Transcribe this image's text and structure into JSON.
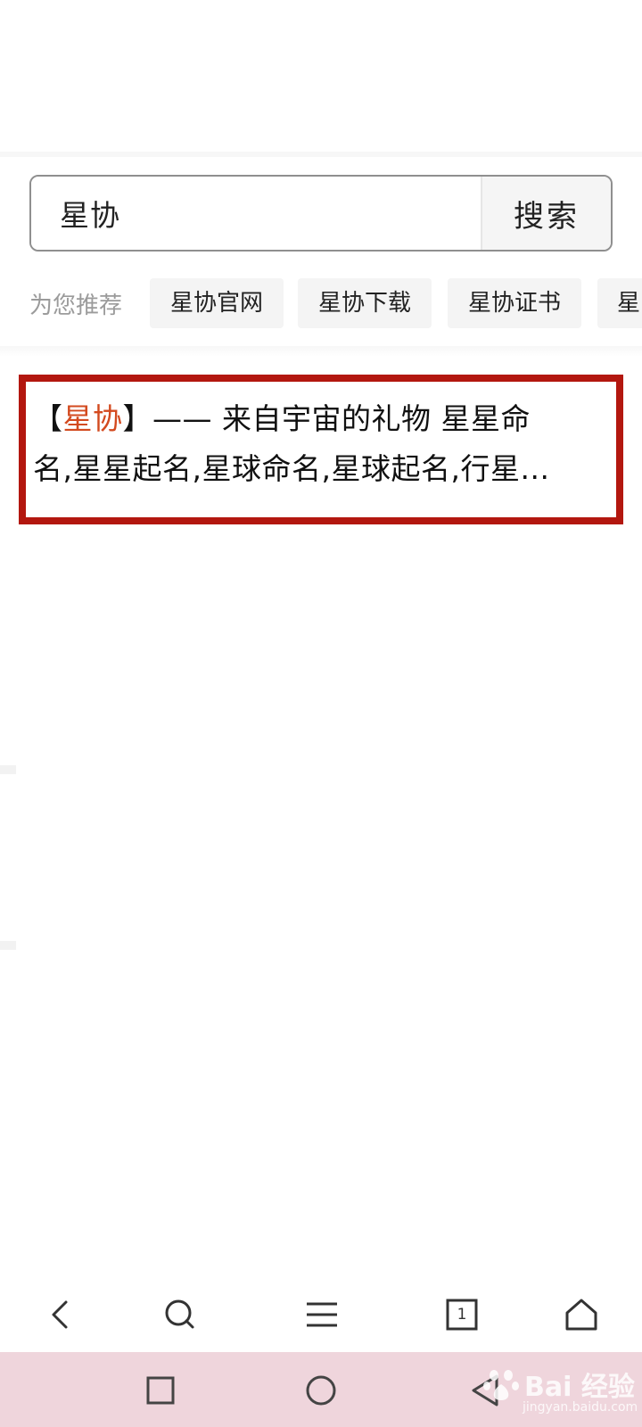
{
  "search": {
    "query": "星协",
    "button_label": "搜索"
  },
  "suggestions": {
    "label": "为您推荐",
    "items": [
      "星协官网",
      "星协下载",
      "星协证书",
      "星"
    ]
  },
  "result": {
    "open_bracket": "【",
    "highlight": "星协",
    "line1_rest": "】—— 来自宇宙的礼物 星星命",
    "line2": "名,星星起名,星球命名,星球起名,行星..."
  },
  "toolbar": {
    "tab_count": "1"
  },
  "watermark": {
    "brand": "Bai  经验",
    "url": "jingyan.baidu.com"
  },
  "colors": {
    "highlight_frame": "#b3170f",
    "keyword": "#d34a1f",
    "nav_bar": "#efd5dc"
  }
}
